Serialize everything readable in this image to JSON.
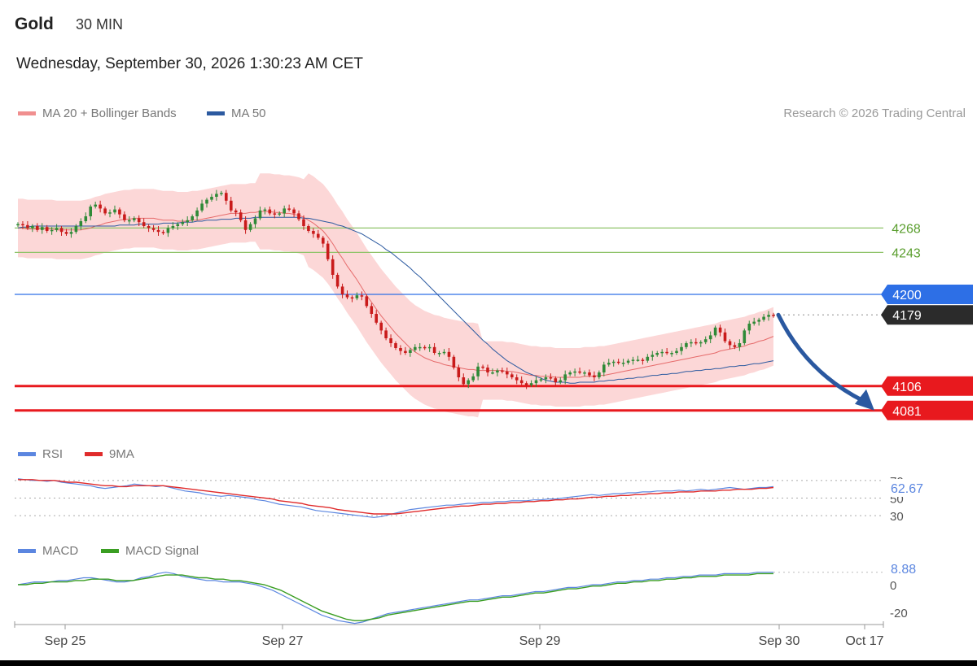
{
  "header": {
    "instrument": "Gold",
    "timeframe": "30 MIN",
    "datetime": "Wednesday, September 30, 2026 1:30:23 AM CET",
    "credit": "Research © 2026 Trading Central"
  },
  "colors": {
    "ma20": "#e05050",
    "bands": "#fcd7d7",
    "bands_legend": "#f08f8f",
    "ma50": "#2c5aa0",
    "resistance": "#8fc46a",
    "resistance_label": "#5a9e2e",
    "pivot": "#2d6fe6",
    "support": "#e8191e",
    "last": "#2b2b2b",
    "up_candle": "#2f8a37",
    "down_candle": "#c91b1b",
    "rsi": "#5b86e0",
    "rsi_ma": "#e02b2b",
    "macd": "#5b86e0",
    "macd_signal": "#3a9e22",
    "forecast_arrow": "#2a58a0"
  },
  "chart_data": [
    {
      "type": "candlestick",
      "panel": "price",
      "title": "",
      "legend": [
        {
          "name": "MA 20 + Bollinger Bands",
          "icon": "legend-swatch"
        },
        {
          "name": "MA 50",
          "icon": "legend-swatch"
        }
      ],
      "x_tick_labels": [
        "Sep 25",
        "Sep 27",
        "Sep 29",
        "Sep 30",
        "Oct 17"
      ],
      "ylim": [
        4060,
        4360
      ],
      "series": {
        "close": [
          4272,
          4271,
          4268,
          4270,
          4266,
          4269,
          4265,
          4266,
          4268,
          4264,
          4262,
          4264,
          4270,
          4275,
          4280,
          4290,
          4292,
          4288,
          4283,
          4284,
          4287,
          4282,
          4276,
          4276,
          4278,
          4274,
          4270,
          4268,
          4266,
          4264,
          4263,
          4268,
          4270,
          4272,
          4274,
          4276,
          4280,
          4286,
          4293,
          4297,
          4300,
          4303,
          4304,
          4296,
          4286,
          4284,
          4276,
          4266,
          4272,
          4278,
          4286,
          4287,
          4283,
          4282,
          4283,
          4288,
          4287,
          4283,
          4277,
          4270,
          4265,
          4262,
          4258,
          4252,
          4236,
          4220,
          4208,
          4200,
          4197,
          4196,
          4199,
          4198,
          4188,
          4180,
          4171,
          4163,
          4155,
          4150,
          4145,
          4142,
          4140,
          4143,
          4146,
          4146,
          4145,
          4146,
          4140,
          4140,
          4141,
          4136,
          4125,
          4115,
          4108,
          4112,
          4116,
          4126,
          4125,
          4120,
          4120,
          4122,
          4121,
          4118,
          4115,
          4112,
          4109,
          4107,
          4109,
          4112,
          4113,
          4115,
          4114,
          4110,
          4112,
          4118,
          4120,
          4121,
          4120,
          4120,
          4117,
          4115,
          4120,
          4128,
          4130,
          4131,
          4130,
          4130,
          4132,
          4133,
          4133,
          4132,
          4136,
          4138,
          4140,
          4141,
          4140,
          4140,
          4142,
          4146,
          4150,
          4151,
          4150,
          4151,
          4154,
          4158,
          4166,
          4161,
          4152,
          4148,
          4146,
          4150,
          4163,
          4170,
          4172,
          4174,
          4177,
          4179,
          4178
        ],
        "ma20": [
          4268,
          4268,
          4267,
          4267,
          4267,
          4267,
          4267,
          4267,
          4266,
          4266,
          4266,
          4266,
          4266,
          4266,
          4267,
          4268,
          4270,
          4271,
          4273,
          4274,
          4275,
          4276,
          4277,
          4277,
          4278,
          4278,
          4278,
          4278,
          4278,
          4277,
          4276,
          4276,
          4276,
          4275,
          4275,
          4275,
          4276,
          4276,
          4277,
          4278,
          4279,
          4280,
          4281,
          4282,
          4283,
          4283,
          4283,
          4283,
          4284,
          4284,
          4285,
          4285,
          4285,
          4284,
          4284,
          4283,
          4283,
          4282,
          4281,
          4279,
          4276,
          4273,
          4269,
          4265,
          4259,
          4252,
          4244,
          4237,
          4229,
          4222,
          4215,
          4207,
          4199,
          4192,
          4185,
          4178,
          4172,
          4166,
          4160,
          4155,
          4150,
          4145,
          4141,
          4138,
          4135,
          4133,
          4131,
          4130,
          4128,
          4127,
          4126,
          4125,
          4124,
          4123,
          4123,
          4122,
          4122,
          4122,
          4122,
          4122,
          4122,
          4121,
          4121,
          4120,
          4119,
          4118,
          4117,
          4117,
          4116,
          4116,
          4116,
          4115,
          4115,
          4115,
          4115,
          4115,
          4115,
          4116,
          4116,
          4116,
          4117,
          4117,
          4118,
          4119,
          4120,
          4121,
          4122,
          4123,
          4124,
          4125,
          4126,
          4127,
          4128,
          4129,
          4130,
          4131,
          4132,
          4133,
          4134,
          4135,
          4136,
          4137,
          4138,
          4139,
          4140,
          4142,
          4143,
          4144,
          4145,
          4146,
          4147,
          4149,
          4150,
          4152,
          4153,
          4155,
          4157
        ],
        "ma50": [
          4268,
          4269,
          4269,
          4270,
          4270,
          4270,
          4270,
          4270,
          4270,
          4270,
          4270,
          4270,
          4270,
          4270,
          4270,
          4270,
          4270,
          4270,
          4270,
          4270,
          4270,
          4271,
          4271,
          4271,
          4271,
          4272,
          4272,
          4272,
          4272,
          4272,
          4273,
          4273,
          4273,
          4273,
          4274,
          4274,
          4274,
          4275,
          4275,
          4276,
          4276,
          4276,
          4277,
          4277,
          4277,
          4278,
          4278,
          4278,
          4278,
          4279,
          4279,
          4279,
          4279,
          4279,
          4279,
          4279,
          4279,
          4279,
          4279,
          4278,
          4278,
          4277,
          4276,
          4275,
          4274,
          4273,
          4271,
          4270,
          4268,
          4266,
          4264,
          4262,
          4259,
          4256,
          4253,
          4250,
          4246,
          4243,
          4239,
          4235,
          4231,
          4227,
          4222,
          4218,
          4213,
          4208,
          4203,
          4198,
          4193,
          4188,
          4183,
          4178,
          4173,
          4168,
          4163,
          4158,
          4153,
          4149,
          4144,
          4140,
          4136,
          4132,
          4129,
          4126,
          4123,
          4120,
          4118,
          4116,
          4114,
          4112,
          4111,
          4110,
          4110,
          4110,
          4109,
          4109,
          4110,
          4110,
          4110,
          4110,
          4111,
          4111,
          4112,
          4112,
          4113,
          4113,
          4114,
          4114,
          4115,
          4115,
          4116,
          4117,
          4117,
          4118,
          4118,
          4119,
          4119,
          4120,
          4121,
          4121,
          4122,
          4122,
          4123,
          4123,
          4124,
          4124,
          4125,
          4126,
          4126,
          4127,
          4127,
          4128,
          4129,
          4129,
          4130,
          4131,
          4132
        ]
      },
      "bollinger_width": 30,
      "levels": [
        {
          "value": 4268,
          "kind": "resistance"
        },
        {
          "value": 4243,
          "kind": "resistance"
        },
        {
          "value": 4200,
          "kind": "pivot"
        },
        {
          "value": 4179,
          "kind": "last"
        },
        {
          "value": 4106,
          "kind": "support"
        },
        {
          "value": 4081,
          "kind": "support"
        }
      ],
      "forecast": {
        "from": 4179,
        "to": 4081,
        "direction": "down"
      }
    },
    {
      "type": "line",
      "panel": "rsi",
      "title": "",
      "legend": [
        {
          "name": "RSI",
          "icon": "legend-swatch"
        },
        {
          "name": "9MA",
          "icon": "legend-swatch"
        }
      ],
      "ylim": [
        20,
        80
      ],
      "reference_lines": [
        70,
        50,
        30
      ],
      "y_tick_labels": [
        "70",
        "50",
        "30"
      ],
      "current_value": "62.67",
      "series": [
        {
          "name": "RSI",
          "values": [
            72,
            71,
            70,
            70,
            69,
            70,
            68,
            67,
            66,
            65,
            64,
            62,
            61,
            62,
            63,
            64,
            66,
            65,
            64,
            63,
            64,
            62,
            60,
            58,
            57,
            56,
            54,
            53,
            52,
            53,
            52,
            51,
            50,
            48,
            47,
            45,
            43,
            42,
            41,
            40,
            38,
            36,
            35,
            34,
            33,
            32,
            31,
            30,
            29,
            28,
            29,
            31,
            33,
            35,
            37,
            38,
            39,
            40,
            41,
            42,
            42,
            43,
            44,
            44,
            45,
            45,
            46,
            46,
            47,
            47,
            47,
            48,
            48,
            49,
            49,
            50,
            51,
            52,
            53,
            54,
            53,
            54,
            55,
            55,
            56,
            56,
            57,
            57,
            58,
            58,
            58,
            59,
            58,
            59,
            60,
            59,
            60,
            61,
            62,
            61,
            60,
            61,
            62,
            62,
            63
          ]
        },
        {
          "name": "9MA",
          "values": [
            71,
            71,
            71,
            70,
            70,
            70,
            69,
            68,
            68,
            67,
            66,
            65,
            64,
            64,
            63,
            63,
            64,
            64,
            64,
            64,
            64,
            63,
            62,
            61,
            60,
            59,
            58,
            57,
            56,
            55,
            54,
            53,
            52,
            51,
            50,
            49,
            47,
            46,
            45,
            44,
            42,
            41,
            40,
            39,
            37,
            36,
            35,
            34,
            33,
            32,
            32,
            32,
            32,
            33,
            34,
            35,
            36,
            37,
            38,
            39,
            40,
            41,
            41,
            42,
            43,
            43,
            44,
            44,
            45,
            45,
            46,
            46,
            47,
            47,
            48,
            48,
            49,
            49,
            50,
            51,
            51,
            52,
            52,
            53,
            53,
            54,
            54,
            55,
            55,
            56,
            56,
            57,
            57,
            57,
            58,
            58,
            58,
            59,
            59,
            60,
            60,
            60,
            61,
            61,
            62
          ]
        }
      ]
    },
    {
      "type": "line",
      "panel": "macd",
      "title": "",
      "legend": [
        {
          "name": "MACD",
          "icon": "legend-swatch"
        },
        {
          "name": "MACD Signal",
          "icon": "legend-swatch"
        }
      ],
      "ylim": [
        -30,
        20
      ],
      "y_tick_labels": [
        "0",
        "-20"
      ],
      "current_value": "8.88",
      "series": [
        {
          "name": "MACD",
          "values": [
            0,
            1,
            2,
            2,
            2,
            3,
            3,
            4,
            5,
            5,
            4,
            3,
            2,
            2,
            3,
            5,
            6,
            8,
            9,
            8,
            6,
            5,
            4,
            3,
            3,
            2,
            2,
            2,
            1,
            0,
            -2,
            -4,
            -7,
            -10,
            -13,
            -16,
            -19,
            -22,
            -24,
            -26,
            -27,
            -28,
            -27,
            -25,
            -23,
            -21,
            -20,
            -19,
            -18,
            -17,
            -16,
            -15,
            -14,
            -13,
            -12,
            -11,
            -11,
            -10,
            -9,
            -8,
            -8,
            -7,
            -6,
            -5,
            -5,
            -4,
            -3,
            -2,
            -2,
            -1,
            0,
            0,
            1,
            2,
            2,
            3,
            3,
            4,
            4,
            5,
            5,
            6,
            6,
            7,
            7,
            7,
            8,
            8,
            8,
            8,
            9,
            9,
            9
          ]
        },
        {
          "name": "MACD Signal",
          "values": [
            0,
            0,
            1,
            1,
            2,
            2,
            2,
            3,
            3,
            4,
            4,
            4,
            3,
            3,
            3,
            4,
            5,
            6,
            7,
            7,
            7,
            6,
            5,
            5,
            4,
            4,
            3,
            3,
            2,
            1,
            0,
            -2,
            -4,
            -7,
            -10,
            -13,
            -16,
            -19,
            -21,
            -23,
            -25,
            -26,
            -26,
            -25,
            -24,
            -22,
            -21,
            -20,
            -19,
            -18,
            -17,
            -16,
            -15,
            -14,
            -13,
            -12,
            -12,
            -11,
            -10,
            -9,
            -9,
            -8,
            -7,
            -6,
            -6,
            -5,
            -4,
            -3,
            -3,
            -2,
            -1,
            -1,
            0,
            1,
            1,
            2,
            2,
            3,
            3,
            4,
            4,
            5,
            5,
            6,
            6,
            6,
            7,
            7,
            7,
            7,
            8,
            8,
            8
          ]
        }
      ]
    }
  ]
}
